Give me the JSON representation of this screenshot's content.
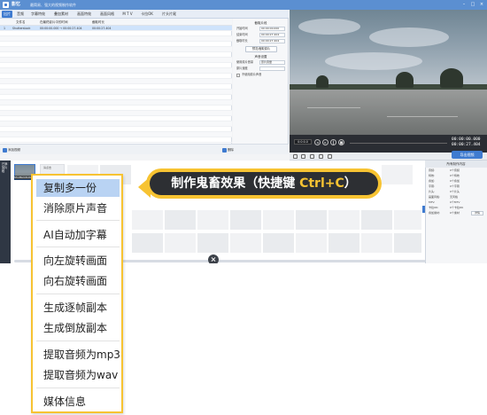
{
  "app": {
    "name": "影忆",
    "slogan": "最简易、强大的视频制作软件",
    "window_controls": [
      "–",
      "□",
      "×"
    ]
  },
  "menubar": {
    "tabs": [
      "出片",
      "音频",
      "字幕特效",
      "叠加素材",
      "画面特效",
      "画面风格",
      "M T V",
      "卡拉OK",
      "片头片尾"
    ],
    "active_index": 0
  },
  "media_list": {
    "columns": [
      "文件名",
      "在最终影片中的时间",
      "截取时长"
    ],
    "rows": [
      {
        "index": "1",
        "name": "Shutterstock",
        "time": "00:00:00.000 → 00:00:27.404",
        "duration": "00:00:27.404"
      }
    ]
  },
  "side_panel": {
    "section1_title": "截取片段",
    "start_label": "开始时间",
    "start_value": "00:00:00.000",
    "end_label": "结束时间",
    "end_value": "00:00:27.404",
    "duration_label": "截取时长",
    "duration_value": "00:00:27.404",
    "preview_button": "预览/截取原片",
    "section2_title": "声音设置",
    "volume_label": "使用原片音量",
    "volume_value": "原片音量",
    "speed_label": "原片速度",
    "checkbox_label": "不使用原片声音",
    "confirm_button": "确认修改"
  },
  "media_toolbar": {
    "add_label": "添加视频",
    "delete_label": "删除"
  },
  "player": {
    "current_time": "00:00:00.000",
    "total_time": "00:00:27.404",
    "export_label": "导出视频",
    "time_box": "0:0:0.0"
  },
  "timeline": {
    "track_label": "已添加片段",
    "clip_name": "Shutterstock",
    "clip2_label": "请点击"
  },
  "right_panel": {
    "title": "所有制作内容",
    "rows": [
      {
        "label": "音频:",
        "value": "0个音频"
      },
      {
        "label": "特效:",
        "value": "0个特效"
      },
      {
        "label": "叠加:",
        "value": "0个叠加"
      },
      {
        "label": "字幕:",
        "value": "0个字幕"
      },
      {
        "label": "片头:",
        "value": "0个片头"
      },
      {
        "label": "画面风格:",
        "value": "无风格"
      },
      {
        "label": "MTV:",
        "value": "0个MTV"
      },
      {
        "label": "卡拉OK:",
        "value": "0个卡拉OK"
      },
      {
        "label": "叠加素材:",
        "value": "0个素材"
      }
    ],
    "detail_button": "详情"
  },
  "tip": {
    "prefix": "制作鬼畜效果（快捷键 ",
    "hotkey": "Ctrl+C",
    "suffix": "）"
  },
  "context_menu": {
    "items": [
      {
        "label": "复制多一份",
        "hover": true
      },
      {
        "label": "消除原片声音"
      },
      {
        "label": "AI自动加字幕"
      },
      {
        "label": "向左旋转画面"
      },
      {
        "label": "向右旋转画面"
      },
      {
        "label": "生成逐帧副本"
      },
      {
        "label": "生成倒放副本"
      },
      {
        "label": "提取音频为mp3"
      },
      {
        "label": "提取音频为wav"
      },
      {
        "label": "媒体信息"
      }
    ]
  },
  "colors": {
    "accent": "#3f7bd0",
    "highlight": "#f7c332",
    "hover": "#b9d3f3"
  }
}
